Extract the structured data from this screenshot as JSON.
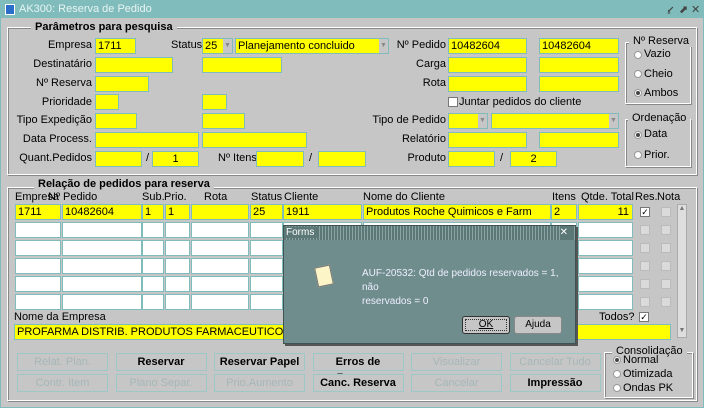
{
  "window": {
    "title": "AK300: Reserva de Pedido"
  },
  "search": {
    "legend": "Parâmetros para pesquisa",
    "empresa_label": "Empresa",
    "empresa": "1711",
    "status_label": "Status",
    "status_code": "25",
    "status_desc": "Planejamento concluido",
    "destinatario_label": "Destinatário",
    "reserva_label": "Nº Reserva",
    "prioridade_label": "Prioridade",
    "tipo_exp_label": "Tipo Expedição",
    "data_proc_label": "Data Process.",
    "quant_label": "Quant.Pedidos",
    "quant_to": "1",
    "sep": "/",
    "itens_label": "Nº Itens",
    "pedido_label": "Nº Pedido",
    "pedido_from": "10482604",
    "pedido_to": "10482604",
    "carga_label": "Carga",
    "rota_label": "Rota",
    "juntar_label": "Juntar pedidos do cliente",
    "tipo_pedido_label": "Tipo de Pedido",
    "relatorio_label": "Relatório",
    "produto_label": "Produto",
    "produto_to": "2"
  },
  "reserva_group": {
    "legend": "Nº Reserva",
    "options": [
      "Vazio",
      "Cheio",
      "Ambos"
    ],
    "selected": "Ambos"
  },
  "ordenacao_group": {
    "legend": "Ordenação",
    "options": [
      "Data",
      "Prior."
    ],
    "selected": "Data"
  },
  "orders": {
    "legend": "Relação de pedidos para reserva",
    "columns": [
      "Empresa",
      "Nº Pedido",
      "Sub.",
      "Prio.",
      "Rota",
      "Status",
      "Cliente",
      "Nome do Cliente",
      "Itens",
      "Qtde. Total",
      "Res.",
      "Nota"
    ],
    "rows": [
      {
        "empresa": "1711",
        "pedido": "10482604",
        "sub": "1",
        "prio": "1",
        "rota": "",
        "status": "25",
        "cliente": "1911",
        "nome": "Produtos Roche Quimicos e Farm",
        "itens": "2",
        "qtde": "11",
        "res": true,
        "nota": false
      }
    ],
    "nome_empresa_label": "Nome da Empresa",
    "nome_empresa": "PROFARMA DISTRIB. PRODUTOS FARMACEUTICOS",
    "todos_label": "Todos?"
  },
  "buttons": {
    "row1": [
      "Relat. Plan.",
      "Reservar",
      "Reservar Papel",
      "Erros de Reserva",
      "Visualizar",
      "Cancelar Tudo"
    ],
    "row2": [
      "Contr. Item",
      "Plano Separ.",
      "Prio.Aumento",
      "Canc. Reserva",
      "Cancelar",
      "Impressão"
    ]
  },
  "consolidacao": {
    "legend": "Consolidação",
    "options": [
      "Normal",
      "Otimizada",
      "Ondas PK"
    ],
    "selected": "Normal"
  },
  "dialog": {
    "title": "Forms",
    "message_line1": "AUF-20532: Qtd de pedidos reservados = 1, não",
    "message_line2": "reservados = 0",
    "ok": "OK",
    "help": "Ajuda"
  }
}
